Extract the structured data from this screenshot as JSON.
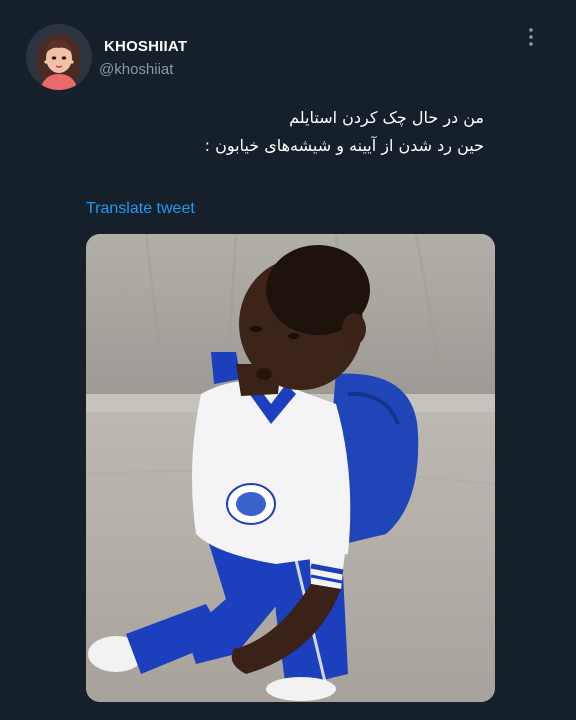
{
  "tweet": {
    "display_name": "KHOSHIIAT",
    "handle": "@khoshiiat",
    "text_lines": [
      "من در حال چک کردن استایلم",
      "حین رد شدن از آیینه و شیشه‌های خیابون :"
    ],
    "translate_label": "Translate tweet"
  },
  "icons": {
    "more": "more-vertical-icon",
    "avatar": "cartoon-avatar"
  },
  "colors": {
    "background": "#15202b",
    "accent": "#1d9bf0",
    "secondary_text": "#8b98a5",
    "primary_text": "#ffffff"
  }
}
